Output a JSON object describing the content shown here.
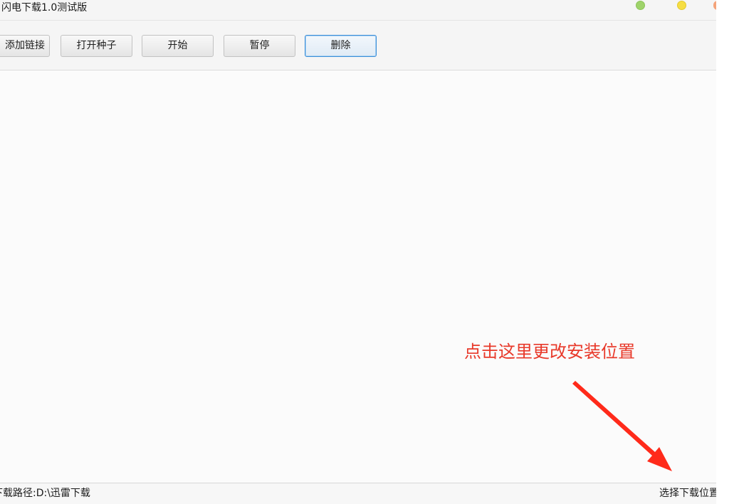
{
  "window": {
    "title": "闪电下载1.0测试版"
  },
  "toolbar": {
    "add_link_label": "添加链接",
    "open_torrent_label": "打开种子",
    "start_label": "开始",
    "pause_label": "暂停",
    "delete_label": "删除"
  },
  "statusbar": {
    "download_path": "下载路径:D:\\迅雷下载",
    "choose_location_label": "选择下载位置"
  },
  "annotation": {
    "text": "点击这里更改安装位置",
    "color": "#e8392a"
  },
  "colors": {
    "window_bg": "#fbfbfb",
    "focused_button_border": "#3b8ed8",
    "window_dot_green": "#9fd36b",
    "window_dot_yellow": "#f6de43",
    "window_dot_red": "#f4a37a"
  },
  "icons": {
    "arrow": "red-arrow-icon"
  }
}
